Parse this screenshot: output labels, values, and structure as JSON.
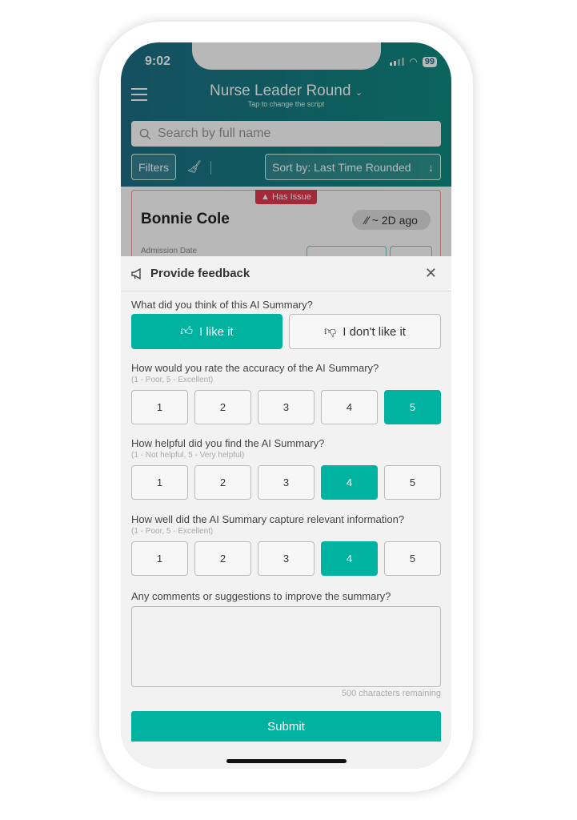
{
  "status_bar": {
    "time": "9:02",
    "battery": "99"
  },
  "header": {
    "title": "Nurse Leader Round",
    "title_icon": "chevron-down-icon",
    "subtitle": "Tap to change the script",
    "search_placeholder": "Search by full name",
    "filters_label": "Filters",
    "sort_label": "Sort by: Last Time Rounded"
  },
  "patient_card": {
    "badge": "Has Issue",
    "name": "Bonnie Cole",
    "last_round": "~ 2D ago",
    "admission_label": "Admission Date"
  },
  "feedback": {
    "title": "Provide feedback",
    "q1": "What did you think of this AI Summary?",
    "like_label": "I like it",
    "dislike_label": "I don't like it",
    "selected": "like",
    "ratings": [
      {
        "question": "How would you rate the accuracy of the AI Summary?",
        "hint": "(1 - Poor, 5 - Excellent)",
        "options": [
          "1",
          "2",
          "3",
          "4",
          "5"
        ],
        "selected": "5"
      },
      {
        "question": "How helpful did you find the AI Summary?",
        "hint": "(1 - Not helpful, 5 - Very helpful)",
        "options": [
          "1",
          "2",
          "3",
          "4",
          "5"
        ],
        "selected": "4"
      },
      {
        "question": "How well did the AI Summary capture relevant information?",
        "hint": "(1 - Poor, 5 - Excellent)",
        "options": [
          "1",
          "2",
          "3",
          "4",
          "5"
        ],
        "selected": "4"
      }
    ],
    "comments_label": "Any comments or suggestions to improve the summary?",
    "comments_value": "",
    "remaining": "500 characters remaining",
    "submit_label": "Submit"
  },
  "colors": {
    "accent": "#00b3a0",
    "issue": "#e03a4e",
    "header_start": "#1d6f86",
    "header_end": "#0f8a80"
  }
}
